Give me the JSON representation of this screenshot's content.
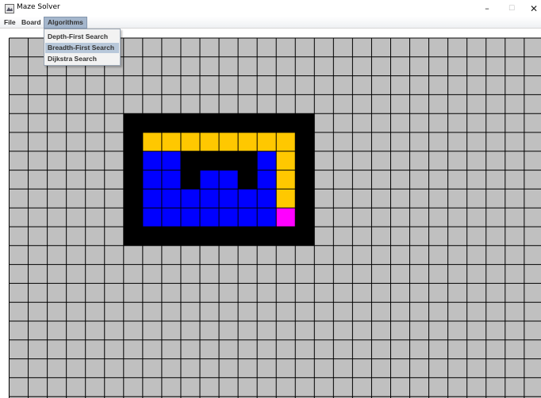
{
  "window": {
    "title": "Maze Solver",
    "minimize_glyph": "–",
    "maximize_glyph": "☐",
    "close_glyph": "✕"
  },
  "menubar": {
    "items": [
      "File",
      "Board",
      "Algorithms"
    ],
    "active": "Algorithms"
  },
  "dropdown": {
    "items": [
      "Depth-First Search",
      "Breadth-First Search",
      "Dijkstra Search"
    ],
    "highlighted": "Breadth-First Search"
  },
  "board": {
    "legend_colors": {
      "empty": "#c0c0c0",
      "wall": "#000000",
      "path": "#ffc800",
      "visited": "#0000ff",
      "target": "#ff00ff",
      "grid_line": "#000000"
    },
    "cells": [
      {
        "row": 4,
        "col": 6,
        "type": "wall"
      },
      {
        "row": 4,
        "col": 7,
        "type": "wall"
      },
      {
        "row": 4,
        "col": 8,
        "type": "wall"
      },
      {
        "row": 4,
        "col": 9,
        "type": "wall"
      },
      {
        "row": 4,
        "col": 10,
        "type": "wall"
      },
      {
        "row": 4,
        "col": 11,
        "type": "wall"
      },
      {
        "row": 4,
        "col": 12,
        "type": "wall"
      },
      {
        "row": 4,
        "col": 13,
        "type": "wall"
      },
      {
        "row": 4,
        "col": 14,
        "type": "wall"
      },
      {
        "row": 4,
        "col": 15,
        "type": "wall"
      },
      {
        "row": 5,
        "col": 6,
        "type": "wall"
      },
      {
        "row": 5,
        "col": 7,
        "type": "path"
      },
      {
        "row": 5,
        "col": 8,
        "type": "path"
      },
      {
        "row": 5,
        "col": 9,
        "type": "path"
      },
      {
        "row": 5,
        "col": 10,
        "type": "path"
      },
      {
        "row": 5,
        "col": 11,
        "type": "path"
      },
      {
        "row": 5,
        "col": 12,
        "type": "path"
      },
      {
        "row": 5,
        "col": 13,
        "type": "path"
      },
      {
        "row": 5,
        "col": 14,
        "type": "path"
      },
      {
        "row": 5,
        "col": 15,
        "type": "wall"
      },
      {
        "row": 6,
        "col": 6,
        "type": "wall"
      },
      {
        "row": 6,
        "col": 7,
        "type": "visited"
      },
      {
        "row": 6,
        "col": 8,
        "type": "visited"
      },
      {
        "row": 6,
        "col": 9,
        "type": "wall"
      },
      {
        "row": 6,
        "col": 10,
        "type": "wall"
      },
      {
        "row": 6,
        "col": 11,
        "type": "wall"
      },
      {
        "row": 6,
        "col": 12,
        "type": "wall"
      },
      {
        "row": 6,
        "col": 13,
        "type": "visited"
      },
      {
        "row": 6,
        "col": 14,
        "type": "path"
      },
      {
        "row": 6,
        "col": 15,
        "type": "wall"
      },
      {
        "row": 7,
        "col": 6,
        "type": "wall"
      },
      {
        "row": 7,
        "col": 7,
        "type": "visited"
      },
      {
        "row": 7,
        "col": 8,
        "type": "visited"
      },
      {
        "row": 7,
        "col": 9,
        "type": "wall"
      },
      {
        "row": 7,
        "col": 10,
        "type": "visited"
      },
      {
        "row": 7,
        "col": 11,
        "type": "visited"
      },
      {
        "row": 7,
        "col": 12,
        "type": "wall"
      },
      {
        "row": 7,
        "col": 13,
        "type": "visited"
      },
      {
        "row": 7,
        "col": 14,
        "type": "path"
      },
      {
        "row": 7,
        "col": 15,
        "type": "wall"
      },
      {
        "row": 8,
        "col": 6,
        "type": "wall"
      },
      {
        "row": 8,
        "col": 7,
        "type": "visited"
      },
      {
        "row": 8,
        "col": 8,
        "type": "visited"
      },
      {
        "row": 8,
        "col": 9,
        "type": "visited"
      },
      {
        "row": 8,
        "col": 10,
        "type": "visited"
      },
      {
        "row": 8,
        "col": 11,
        "type": "visited"
      },
      {
        "row": 8,
        "col": 12,
        "type": "visited"
      },
      {
        "row": 8,
        "col": 13,
        "type": "visited"
      },
      {
        "row": 8,
        "col": 14,
        "type": "path"
      },
      {
        "row": 8,
        "col": 15,
        "type": "wall"
      },
      {
        "row": 9,
        "col": 6,
        "type": "wall"
      },
      {
        "row": 9,
        "col": 7,
        "type": "visited"
      },
      {
        "row": 9,
        "col": 8,
        "type": "visited"
      },
      {
        "row": 9,
        "col": 9,
        "type": "visited"
      },
      {
        "row": 9,
        "col": 10,
        "type": "visited"
      },
      {
        "row": 9,
        "col": 11,
        "type": "visited"
      },
      {
        "row": 9,
        "col": 12,
        "type": "visited"
      },
      {
        "row": 9,
        "col": 13,
        "type": "visited"
      },
      {
        "row": 9,
        "col": 14,
        "type": "target"
      },
      {
        "row": 9,
        "col": 15,
        "type": "wall"
      },
      {
        "row": 10,
        "col": 6,
        "type": "wall"
      },
      {
        "row": 10,
        "col": 7,
        "type": "wall"
      },
      {
        "row": 10,
        "col": 8,
        "type": "wall"
      },
      {
        "row": 10,
        "col": 9,
        "type": "wall"
      },
      {
        "row": 10,
        "col": 10,
        "type": "wall"
      },
      {
        "row": 10,
        "col": 11,
        "type": "wall"
      },
      {
        "row": 10,
        "col": 12,
        "type": "wall"
      },
      {
        "row": 10,
        "col": 13,
        "type": "wall"
      },
      {
        "row": 10,
        "col": 14,
        "type": "wall"
      },
      {
        "row": 10,
        "col": 15,
        "type": "wall"
      }
    ]
  }
}
